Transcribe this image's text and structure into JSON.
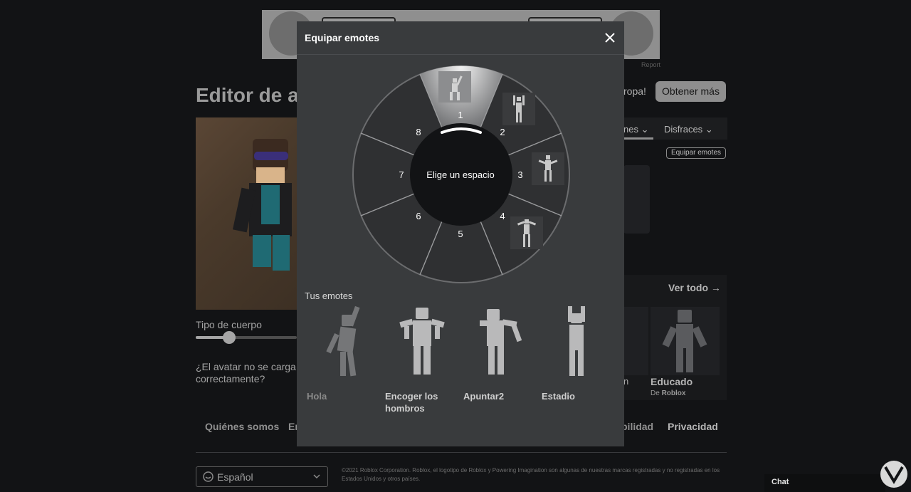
{
  "ad": {
    "report": "Report"
  },
  "page": {
    "title": "Editor de a",
    "promo_fragment": "ropa!",
    "get_more": "Obtener más",
    "tabs": [
      {
        "label": "nes"
      },
      {
        "label": "Disfraces"
      }
    ],
    "equip_emotes_link": "Equipar emotes",
    "body_type_label": "Tipo de cuerpo",
    "body_type_level": 0.34,
    "avatar_question": "¿El avatar no se carga correctamente?",
    "see_all": "Ver todo",
    "recommended": [
      {
        "name": "n"
      },
      {
        "name": "Educado",
        "by_prefix": "De",
        "by": "Roblox"
      }
    ]
  },
  "footer": {
    "links": [
      "Quiénes somos",
      "En",
      "bilidad",
      "Privacidad"
    ],
    "language": "Español",
    "copyright": "©2021 Roblox Corporation. Roblox, el logotipo de Roblox y Powering Imagination son algunas de nuestras marcas registradas y no registradas en los Estados Unidos y otros países."
  },
  "chat": {
    "label": "Chat"
  },
  "modal": {
    "title": "Equipar emotes",
    "center_label": "Elige un espacio",
    "slots": [
      "1",
      "2",
      "3",
      "4",
      "5",
      "6",
      "7",
      "8"
    ],
    "your_emotes_label": "Tus emotes",
    "emotes": [
      {
        "name": "Hola",
        "dimmed": true
      },
      {
        "name": "Encoger los hombros",
        "dimmed": false
      },
      {
        "name": "Apuntar2",
        "dimmed": false
      },
      {
        "name": "Estadio",
        "dimmed": false
      }
    ]
  },
  "colors": {
    "modal_bg": "#393b3d",
    "wheel_bg": "#2f3032",
    "page_bg": "#121315"
  }
}
